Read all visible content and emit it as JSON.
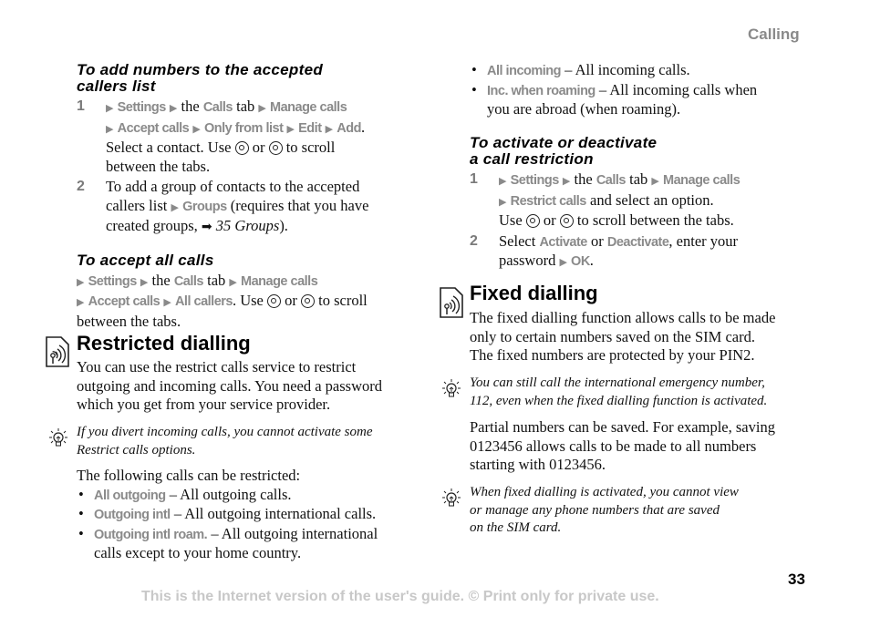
{
  "header": {
    "section": "Calling"
  },
  "left": {
    "add_numbers": {
      "title_line1": "To add numbers to the accepted",
      "title_line2": "callers list",
      "step1": {
        "num": "1",
        "settings": "Settings",
        "the": "the",
        "calls": "Calls",
        "tab": "tab",
        "manage": "Manage calls",
        "accept": "Accept calls",
        "only_from": "Only from list",
        "edit": "Edit",
        "add": "Add",
        "select_text": "Select a contact. Use",
        "or": "or",
        "scroll_text": "to scroll",
        "between": "between the tabs."
      },
      "step2": {
        "num": "2",
        "line1": "To add a group of contacts to the accepted",
        "line2_a": "callers list",
        "groups": "Groups",
        "line2_b": "(requires that you have",
        "line3_a": "created groups,",
        "ref": "35 Groups",
        "line3_b": ")."
      }
    },
    "accept_all": {
      "title": "To accept all calls",
      "settings": "Settings",
      "the": "the",
      "calls": "Calls",
      "tab": "tab",
      "manage": "Manage calls",
      "accept": "Accept calls",
      "all_callers": "All callers",
      "use": ". Use",
      "or": "or",
      "scroll": "to scroll",
      "between": "between the tabs."
    },
    "restricted": {
      "heading": "Restricted dialling",
      "body": [
        "You can use the restrict calls service to restrict",
        "outgoing and incoming calls. You need a password",
        "which you get from your service provider."
      ],
      "tip": [
        "If you divert incoming calls, you cannot activate some",
        "Restrict calls options."
      ],
      "intro": "The following calls can be restricted:",
      "items": [
        {
          "label": "All outgoing",
          "desc": "– All outgoing calls.",
          "desc2": ""
        },
        {
          "label": "Outgoing intl",
          "desc": "– All outgoing international calls.",
          "desc2": ""
        },
        {
          "label": "Outgoing intl roam.",
          "desc": "– All outgoing international",
          "desc2": "calls except to your home country."
        }
      ]
    }
  },
  "right": {
    "items": [
      {
        "label": "All incoming",
        "desc": "– All incoming calls.",
        "desc2": ""
      },
      {
        "label": "Inc. when roaming",
        "desc": "– All incoming calls when",
        "desc2": "you are abroad (when roaming)."
      }
    ],
    "activate": {
      "title_line1": "To activate or deactivate",
      "title_line2": "a call restriction",
      "step1": {
        "num": "1",
        "settings": "Settings",
        "the": "the",
        "calls": "Calls",
        "tab": "tab",
        "manage": "Manage calls",
        "restrict": "Restrict calls",
        "select": "and select an option.",
        "use": "Use",
        "or": "or",
        "scroll": "to scroll between the tabs."
      },
      "step2": {
        "num": "2",
        "select": "Select",
        "activate": "Activate",
        "or": "or",
        "deactivate": "Deactivate",
        "enter": ", enter your",
        "password": "password",
        "ok": "OK",
        "end": "."
      }
    },
    "fixed": {
      "heading": "Fixed dialling",
      "body": [
        "The fixed dialling function allows calls to be made",
        "only to certain numbers saved on the SIM card.",
        "The fixed numbers are protected by your PIN2."
      ],
      "tip1": [
        "You can still call the international emergency number,",
        "112, even when the fixed dialling function is activated."
      ],
      "partial": [
        "Partial numbers can be saved. For example, saving",
        "0123456 allows calls to be made to all numbers",
        "starting with 0123456."
      ],
      "tip2": [
        "When fixed dialling is activated, you cannot view",
        "or manage any phone numbers that are saved",
        "on the SIM card."
      ]
    }
  },
  "footer": {
    "page_number": "33",
    "notice": "This is the Internet version of the user's guide. © Print only for private use."
  }
}
